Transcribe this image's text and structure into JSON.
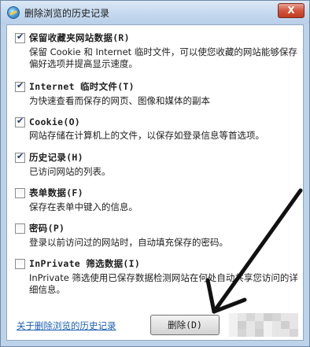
{
  "window": {
    "title": "删除浏览的历史记录",
    "close_label": "X"
  },
  "options": [
    {
      "title": "保留收藏夹网站数据(R)",
      "checked": true,
      "description": "保留 Cookie 和 Internet 临时文件，可以使您收藏的网站能够保存偏好选项并提高显示速度。"
    },
    {
      "title": "Internet 临时文件(T)",
      "checked": true,
      "description": "为快速查看而保存的网页、图像和媒体的副本"
    },
    {
      "title": "Cookie(O)",
      "checked": true,
      "description": "网站存储在计算机上的文件，以保存如登录信息等首选项。"
    },
    {
      "title": "历史记录(H)",
      "checked": true,
      "description": "已访问网站的列表。"
    },
    {
      "title": "表单数据(F)",
      "checked": false,
      "description": "保存在表单中键入的信息。"
    },
    {
      "title": "密码(P)",
      "checked": false,
      "description": "登录以前访问过的网站时，自动填充保存的密码。"
    },
    {
      "title": "InPrivate 筛选数据(I)",
      "checked": false,
      "description": "InPrivate 筛选使用已保存数据检测网站在何处自动共享您访问的详细信息。"
    }
  ],
  "footer": {
    "link_label": "关于删除浏览的历史记录",
    "delete_label": "删除(D)"
  }
}
